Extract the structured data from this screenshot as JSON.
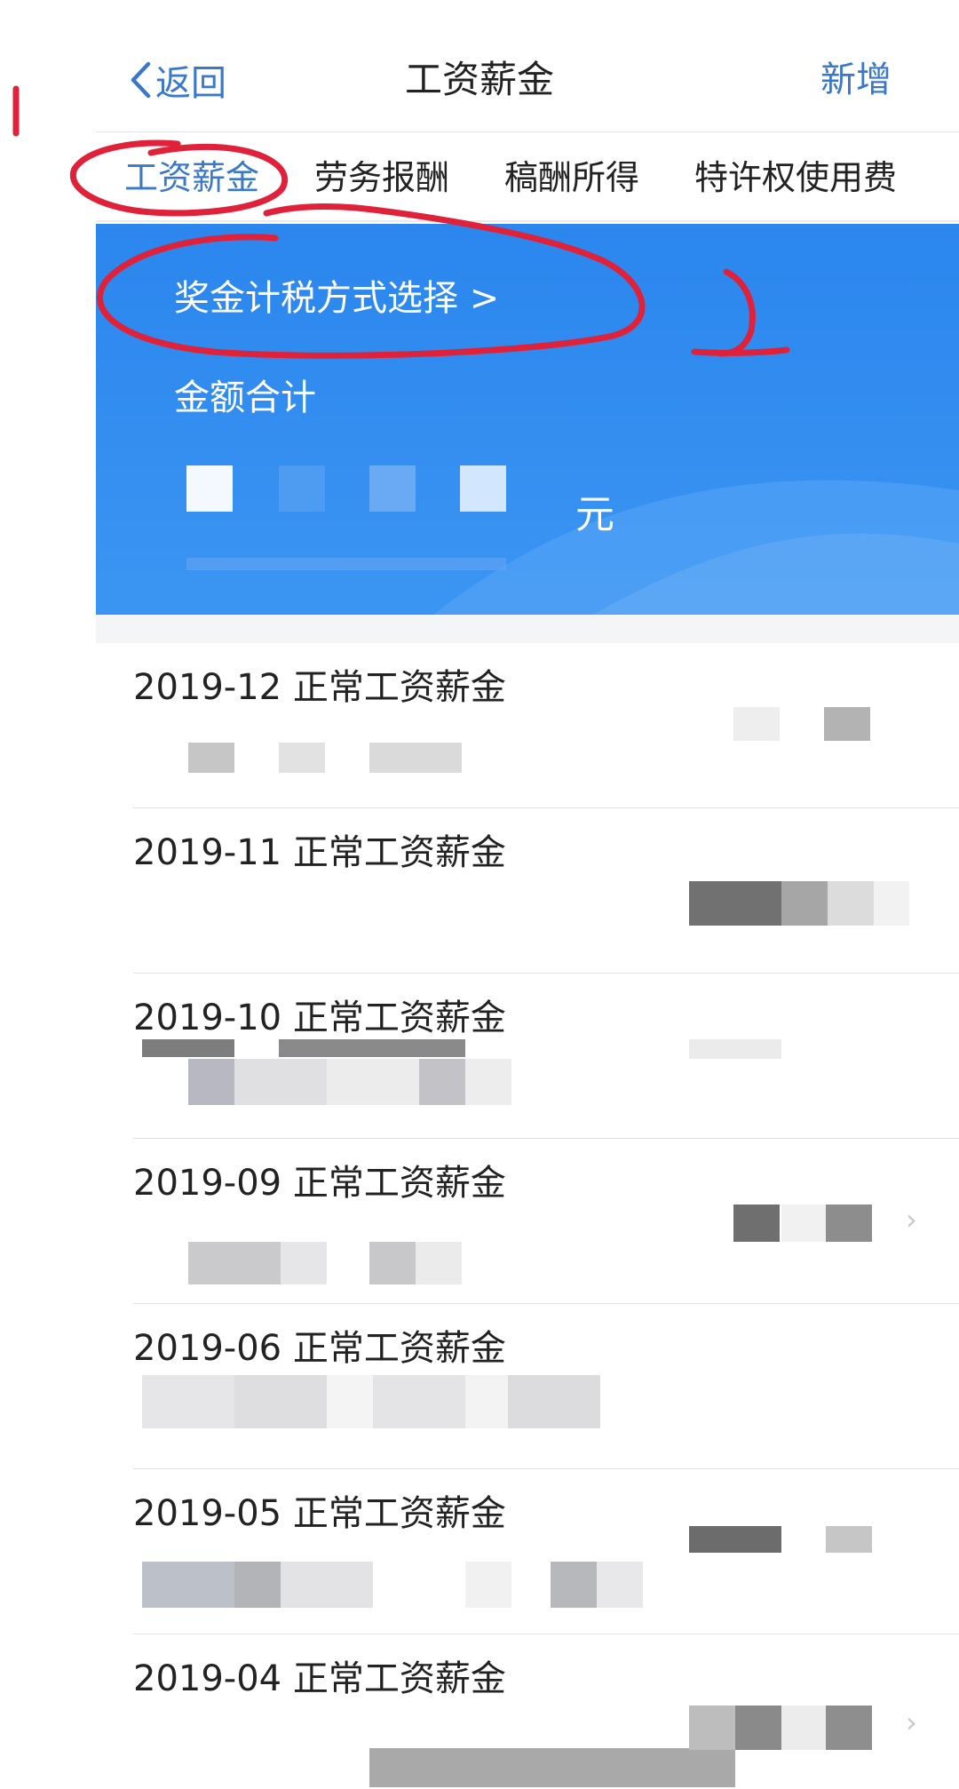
{
  "nav": {
    "back_label": "返回",
    "title": "工资薪金",
    "add_label": "新增"
  },
  "tabs": [
    {
      "label": "工资薪金",
      "active": true
    },
    {
      "label": "劳务报酬",
      "active": false
    },
    {
      "label": "稿酬所得",
      "active": false
    },
    {
      "label": "特许权使用费",
      "active": false
    }
  ],
  "banner": {
    "link_label": "奖金计税方式选择 >",
    "sum_label": "金额合计",
    "unit": "元"
  },
  "records": [
    {
      "title": "2019-12 正常工资薪金"
    },
    {
      "title": "2019-11 正常工资薪金"
    },
    {
      "title": "2019-10 正常工资薪金"
    },
    {
      "title": "2019-09 正常工资薪金"
    },
    {
      "title": "2019-06 正常工资薪金"
    },
    {
      "title": "2019-05 正常工资薪金"
    },
    {
      "title": "2019-04 正常工资薪金"
    }
  ],
  "colors": {
    "accent": "#3a78c9",
    "banner": "#2f8df0",
    "annotation": "#e0213a"
  },
  "icons": [
    "chevron-left-icon",
    "chevron-right-icon"
  ]
}
